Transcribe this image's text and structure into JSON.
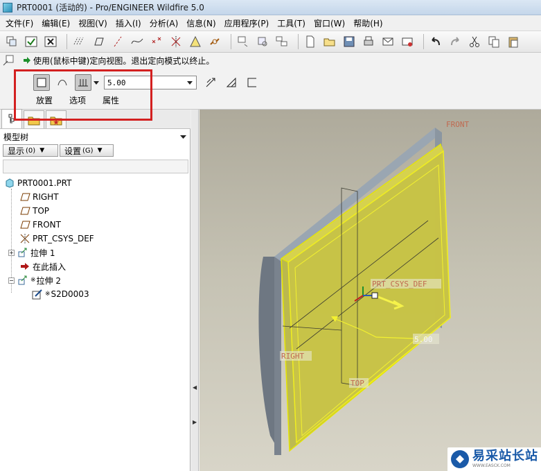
{
  "window": {
    "title": "PRT0001 (活动的) - Pro/ENGINEER Wildfire 5.0"
  },
  "menu": [
    "文件(F)",
    "编辑(E)",
    "视图(V)",
    "插入(I)",
    "分析(A)",
    "信息(N)",
    "应用程序(P)",
    "工具(T)",
    "窗口(W)",
    "帮助(H)"
  ],
  "message": {
    "text": "使用(鼠标中键)定向视图。退出定向模式以终止。"
  },
  "dashboard": {
    "depth_value": "5.00",
    "tabs": [
      "放置",
      "选项",
      "属性"
    ]
  },
  "model_tree": {
    "header": "模型树",
    "show_button": "显示",
    "show_key": "(0)",
    "settings_button": "设置",
    "settings_key": "(G)",
    "items": [
      {
        "label": "PRT0001.PRT",
        "icon": "part-icon"
      },
      {
        "label": "RIGHT",
        "icon": "datum-plane-icon"
      },
      {
        "label": "TOP",
        "icon": "datum-plane-icon"
      },
      {
        "label": "FRONT",
        "icon": "datum-plane-icon"
      },
      {
        "label": "PRT_CSYS_DEF",
        "icon": "csys-icon"
      },
      {
        "label": "拉伸 1",
        "icon": "extrude-icon"
      },
      {
        "label": "在此插入",
        "icon": "insert-here-icon"
      },
      {
        "label": "拉伸 2",
        "icon": "extrude-icon"
      },
      {
        "label": "S2D0003",
        "icon": "sketch-icon"
      }
    ]
  },
  "viewport": {
    "labels": {
      "front": "FRONT",
      "right": "RIGHT",
      "top": "TOP",
      "csys": "PRT_CSYS_DEF",
      "dimension": "5.00"
    }
  },
  "watermark": {
    "text": "易采站长站",
    "url_text": "WWW.EASCK.COM"
  },
  "colors": {
    "highlight": "#d32020",
    "extrude_preview": "#e6e600",
    "part": "#a9b7c4"
  }
}
